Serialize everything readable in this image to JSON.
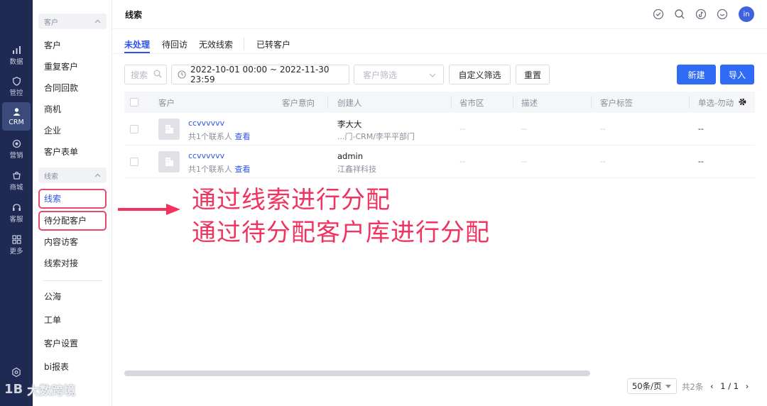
{
  "rail": {
    "items": [
      {
        "label": "数据",
        "icon": "chart-icon"
      },
      {
        "label": "管控",
        "icon": "shield-icon"
      },
      {
        "label": "CRM",
        "icon": "user-icon"
      },
      {
        "label": "营销",
        "icon": "target-icon"
      },
      {
        "label": "商城",
        "icon": "shop-icon"
      },
      {
        "label": "客服",
        "icon": "headset-icon"
      },
      {
        "label": "更多",
        "icon": "grid-icon"
      }
    ],
    "active": "CRM"
  },
  "sidebar": {
    "group1": "客户",
    "group1_items": [
      "客户",
      "重复客户",
      "合同回款",
      "商机",
      "企业",
      "客户表单"
    ],
    "group2": "线索",
    "group2_items": [
      "线索",
      "待分配客户",
      "内容访客",
      "线索对接"
    ],
    "bottom_items": [
      "公海",
      "工单",
      "客户设置",
      "bi报表"
    ]
  },
  "header": {
    "title": "线索",
    "avatar_text": "in"
  },
  "tabs": [
    "未处理",
    "待回访",
    "无效线索",
    "已转客户"
  ],
  "active_tab": "未处理",
  "filters": {
    "search_placeholder": "搜索",
    "date_range": "2022-10-01 00:00 ~ 2022-11-30 23:59",
    "customer_filter_placeholder": "客户筛选",
    "custom_filter_btn": "自定义筛选",
    "reset_btn": "重置",
    "new_btn": "新建",
    "import_btn": "导入"
  },
  "table": {
    "columns": [
      "客户",
      "客户意向",
      "创建人",
      "省市区",
      "描述",
      "客户标签",
      "单选-勿动"
    ],
    "rows": [
      {
        "name": "ccvvvvvv",
        "contacts": "共1个联系人",
        "view": "查看",
        "creator": "李大大",
        "creator_dept": "...门-CRM/李平平部门",
        "region": "--",
        "desc": "--",
        "tags": "--",
        "radio": "--"
      },
      {
        "name": "ccvvvvvv",
        "contacts": "共1个联系人",
        "view": "查看",
        "creator": "admin",
        "creator_dept": "江鑫祥科技",
        "region": "--",
        "desc": "--",
        "tags": "--",
        "radio": "--"
      }
    ]
  },
  "pagination": {
    "page_size": "50条/页",
    "total": "共2条",
    "page": "1 / 1"
  },
  "annotation": {
    "line1": "通过线索进行分配",
    "line2": "通过待分配客户库进行分配",
    "color": "#f0345f"
  },
  "watermark": {
    "mark": "1B",
    "text": "大数跨境"
  }
}
